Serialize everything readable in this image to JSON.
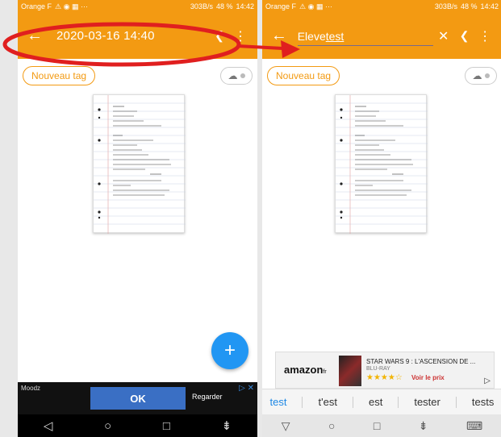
{
  "left": {
    "status": {
      "carrier": "Orange F",
      "net": "303B/s",
      "battery": "48 %",
      "time": "14:42"
    },
    "appbar": {
      "title": "2020-03-16 14:40"
    },
    "tag_button": "Nouveau tag",
    "fab": "+",
    "ad": {
      "brand": "Moodz",
      "ok": "OK",
      "cta": "Regarder"
    }
  },
  "right": {
    "status": {
      "carrier": "Orange F",
      "net": "303B/s",
      "battery": "48 %",
      "time": "14:42"
    },
    "search": {
      "value_plain": "Eleve ",
      "value_underlined": "test"
    },
    "tag_button": "Nouveau tag",
    "amazon": {
      "logo": "amazon",
      "logo_suffix": "fr",
      "product": "STAR WARS 9 : L'ASCENSION DE ...",
      "format": "BLU-RAY",
      "rating_stars": 3.5,
      "cta": "Voir le prix"
    },
    "suggestions": [
      "test",
      "t'est",
      "est",
      "tester",
      "tests"
    ]
  },
  "colors": {
    "accent": "#f39a12",
    "fab": "#2196f3",
    "annotation": "#e01f1f",
    "suggestion_selected": "#1e88e5"
  }
}
